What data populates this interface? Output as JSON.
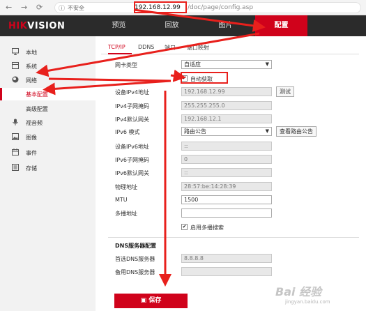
{
  "browser": {
    "back_icon": "←",
    "forward_icon": "→",
    "reload_icon": "⟳",
    "info_icon": "ⓘ",
    "insecure_label": "不安全",
    "url_host": "192.168.12.99",
    "url_path": "/doc/page/config.asp"
  },
  "brand": {
    "logo_part1": "HIK",
    "logo_part2": "VISION",
    "logo_color": "#d0021b"
  },
  "topnav": {
    "tabs": [
      {
        "label": "预览"
      },
      {
        "label": "回放"
      },
      {
        "label": "图片"
      },
      {
        "label": "配置",
        "active": true
      }
    ]
  },
  "sidebar": {
    "items": [
      {
        "label": "本地",
        "icon": "monitor-icon"
      },
      {
        "label": "系统",
        "icon": "system-icon"
      },
      {
        "label": "网络",
        "icon": "globe-icon"
      },
      {
        "label": "基本配置",
        "sub": true,
        "active": true
      },
      {
        "label": "高级配置",
        "sub": true
      },
      {
        "label": "视音频",
        "icon": "audio-video-icon"
      },
      {
        "label": "图像",
        "icon": "image-icon"
      },
      {
        "label": "事件",
        "icon": "event-icon"
      },
      {
        "label": "存储",
        "icon": "storage-icon"
      }
    ]
  },
  "subtabs": [
    {
      "label": "TCP/IP",
      "active": true
    },
    {
      "label": "DDNS"
    },
    {
      "label": "端口"
    },
    {
      "label": "端口映射"
    }
  ],
  "form": {
    "nic_type_label": "网卡类型",
    "nic_type_value": "自适应",
    "dhcp_label": "自动获取",
    "dhcp_checked": true,
    "ipv4_addr_label": "设备IPv4地址",
    "ipv4_addr_value": "192.168.12.99",
    "test_button": "测试",
    "ipv4_mask_label": "IPv4子网掩码",
    "ipv4_mask_value": "255.255.255.0",
    "ipv4_gw_label": "IPv4默认网关",
    "ipv4_gw_value": "192.168.12.1",
    "ipv6_mode_label": "IPv6 模式",
    "ipv6_mode_value": "路由公告",
    "view_route_button": "查看路由公告",
    "ipv6_addr_label": "设备IPv6地址",
    "ipv6_addr_value": "::",
    "ipv6_mask_label": "IPv6子网掩码",
    "ipv6_mask_value": "0",
    "ipv6_gw_label": "IPv6默认网关",
    "ipv6_gw_value": "::",
    "mac_label": "物理地址",
    "mac_value": "28:57:be:14:28:39",
    "mtu_label": "MTU",
    "mtu_value": "1500",
    "multicast_label": "多播地址",
    "multicast_value": "",
    "multicast_search_label": "启用多播搜索",
    "multicast_search_checked": true,
    "dns_section_title": "DNS服务器配置",
    "dns1_label": "首选DNS服务器",
    "dns1_value": "8.8.8.8",
    "dns2_label": "备用DNS服务器",
    "dns2_value": ""
  },
  "save": {
    "label": "保存",
    "icon": "save-icon"
  },
  "watermark": {
    "text": "Bai 经验",
    "sub": "jingyan.baidu.com"
  },
  "annotation_color": "#e8201c"
}
